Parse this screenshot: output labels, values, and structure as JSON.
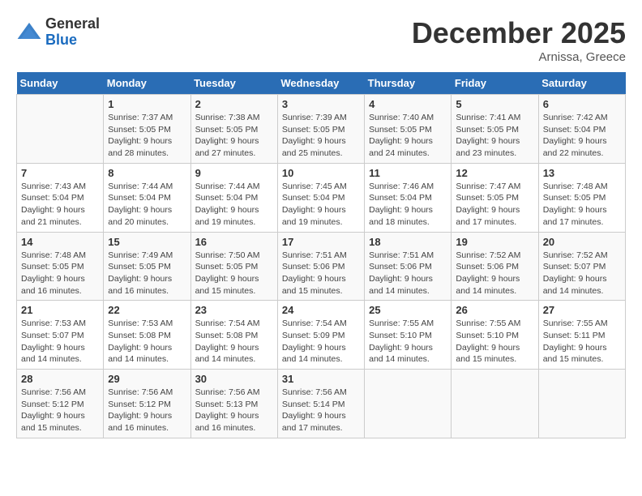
{
  "header": {
    "logo_general": "General",
    "logo_blue": "Blue",
    "month_title": "December 2025",
    "location": "Arnissa, Greece"
  },
  "weekdays": [
    "Sunday",
    "Monday",
    "Tuesday",
    "Wednesday",
    "Thursday",
    "Friday",
    "Saturday"
  ],
  "weeks": [
    [
      {
        "day": "",
        "info": ""
      },
      {
        "day": "1",
        "info": "Sunrise: 7:37 AM\nSunset: 5:05 PM\nDaylight: 9 hours\nand 28 minutes."
      },
      {
        "day": "2",
        "info": "Sunrise: 7:38 AM\nSunset: 5:05 PM\nDaylight: 9 hours\nand 27 minutes."
      },
      {
        "day": "3",
        "info": "Sunrise: 7:39 AM\nSunset: 5:05 PM\nDaylight: 9 hours\nand 25 minutes."
      },
      {
        "day": "4",
        "info": "Sunrise: 7:40 AM\nSunset: 5:05 PM\nDaylight: 9 hours\nand 24 minutes."
      },
      {
        "day": "5",
        "info": "Sunrise: 7:41 AM\nSunset: 5:05 PM\nDaylight: 9 hours\nand 23 minutes."
      },
      {
        "day": "6",
        "info": "Sunrise: 7:42 AM\nSunset: 5:04 PM\nDaylight: 9 hours\nand 22 minutes."
      }
    ],
    [
      {
        "day": "7",
        "info": "Sunrise: 7:43 AM\nSunset: 5:04 PM\nDaylight: 9 hours\nand 21 minutes."
      },
      {
        "day": "8",
        "info": "Sunrise: 7:44 AM\nSunset: 5:04 PM\nDaylight: 9 hours\nand 20 minutes."
      },
      {
        "day": "9",
        "info": "Sunrise: 7:44 AM\nSunset: 5:04 PM\nDaylight: 9 hours\nand 19 minutes."
      },
      {
        "day": "10",
        "info": "Sunrise: 7:45 AM\nSunset: 5:04 PM\nDaylight: 9 hours\nand 19 minutes."
      },
      {
        "day": "11",
        "info": "Sunrise: 7:46 AM\nSunset: 5:04 PM\nDaylight: 9 hours\nand 18 minutes."
      },
      {
        "day": "12",
        "info": "Sunrise: 7:47 AM\nSunset: 5:05 PM\nDaylight: 9 hours\nand 17 minutes."
      },
      {
        "day": "13",
        "info": "Sunrise: 7:48 AM\nSunset: 5:05 PM\nDaylight: 9 hours\nand 17 minutes."
      }
    ],
    [
      {
        "day": "14",
        "info": "Sunrise: 7:48 AM\nSunset: 5:05 PM\nDaylight: 9 hours\nand 16 minutes."
      },
      {
        "day": "15",
        "info": "Sunrise: 7:49 AM\nSunset: 5:05 PM\nDaylight: 9 hours\nand 16 minutes."
      },
      {
        "day": "16",
        "info": "Sunrise: 7:50 AM\nSunset: 5:05 PM\nDaylight: 9 hours\nand 15 minutes."
      },
      {
        "day": "17",
        "info": "Sunrise: 7:51 AM\nSunset: 5:06 PM\nDaylight: 9 hours\nand 15 minutes."
      },
      {
        "day": "18",
        "info": "Sunrise: 7:51 AM\nSunset: 5:06 PM\nDaylight: 9 hours\nand 14 minutes."
      },
      {
        "day": "19",
        "info": "Sunrise: 7:52 AM\nSunset: 5:06 PM\nDaylight: 9 hours\nand 14 minutes."
      },
      {
        "day": "20",
        "info": "Sunrise: 7:52 AM\nSunset: 5:07 PM\nDaylight: 9 hours\nand 14 minutes."
      }
    ],
    [
      {
        "day": "21",
        "info": "Sunrise: 7:53 AM\nSunset: 5:07 PM\nDaylight: 9 hours\nand 14 minutes."
      },
      {
        "day": "22",
        "info": "Sunrise: 7:53 AM\nSunset: 5:08 PM\nDaylight: 9 hours\nand 14 minutes."
      },
      {
        "day": "23",
        "info": "Sunrise: 7:54 AM\nSunset: 5:08 PM\nDaylight: 9 hours\nand 14 minutes."
      },
      {
        "day": "24",
        "info": "Sunrise: 7:54 AM\nSunset: 5:09 PM\nDaylight: 9 hours\nand 14 minutes."
      },
      {
        "day": "25",
        "info": "Sunrise: 7:55 AM\nSunset: 5:10 PM\nDaylight: 9 hours\nand 14 minutes."
      },
      {
        "day": "26",
        "info": "Sunrise: 7:55 AM\nSunset: 5:10 PM\nDaylight: 9 hours\nand 15 minutes."
      },
      {
        "day": "27",
        "info": "Sunrise: 7:55 AM\nSunset: 5:11 PM\nDaylight: 9 hours\nand 15 minutes."
      }
    ],
    [
      {
        "day": "28",
        "info": "Sunrise: 7:56 AM\nSunset: 5:12 PM\nDaylight: 9 hours\nand 15 minutes."
      },
      {
        "day": "29",
        "info": "Sunrise: 7:56 AM\nSunset: 5:12 PM\nDaylight: 9 hours\nand 16 minutes."
      },
      {
        "day": "30",
        "info": "Sunrise: 7:56 AM\nSunset: 5:13 PM\nDaylight: 9 hours\nand 16 minutes."
      },
      {
        "day": "31",
        "info": "Sunrise: 7:56 AM\nSunset: 5:14 PM\nDaylight: 9 hours\nand 17 minutes."
      },
      {
        "day": "",
        "info": ""
      },
      {
        "day": "",
        "info": ""
      },
      {
        "day": "",
        "info": ""
      }
    ]
  ]
}
